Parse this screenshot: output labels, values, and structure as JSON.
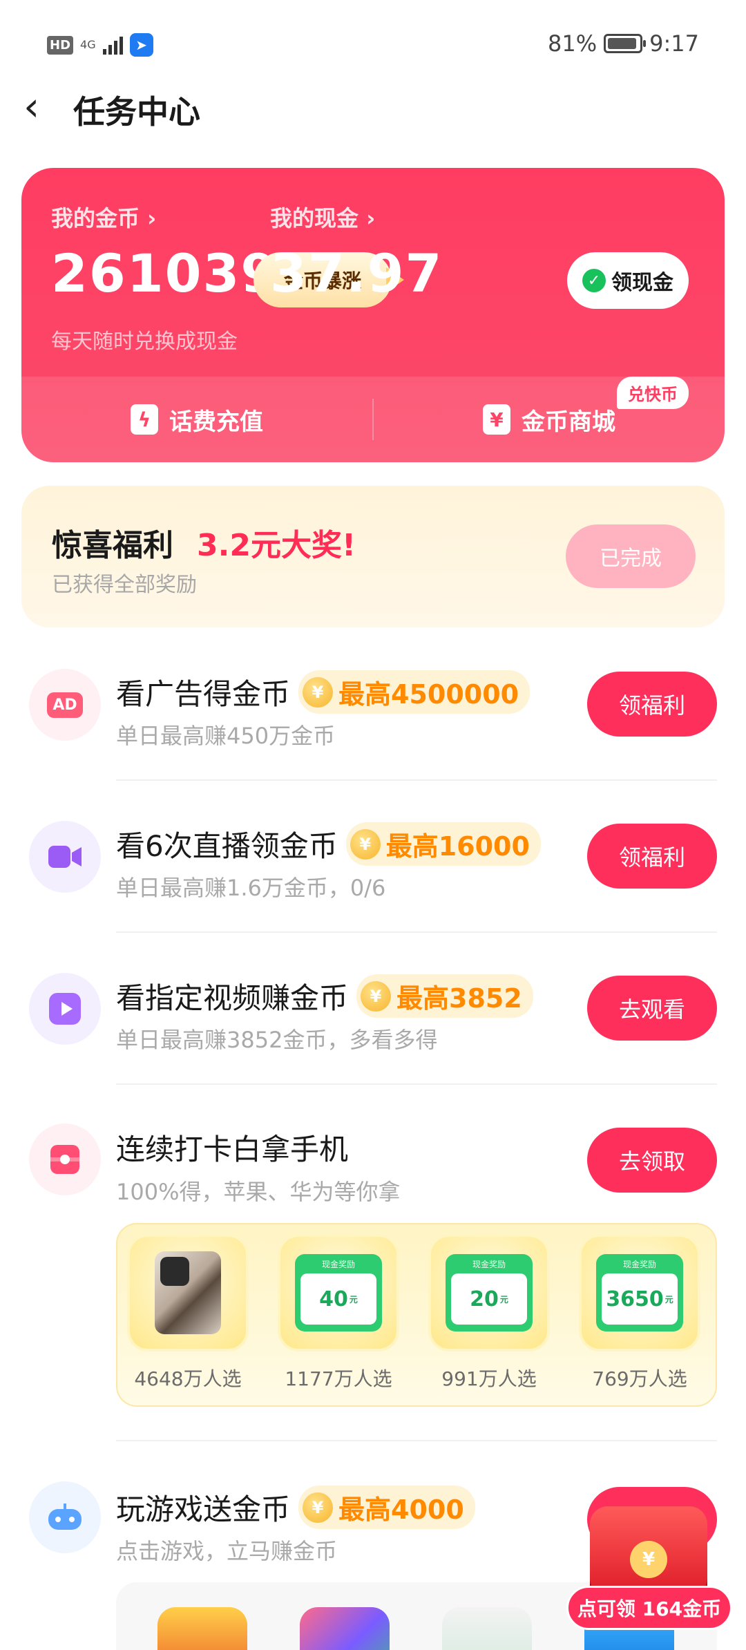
{
  "status_bar": {
    "hd": "HD",
    "signal": "4G",
    "battery_percent": "81%",
    "battery_level": 0.81,
    "time": "9:17"
  },
  "header": {
    "title": "任务中心"
  },
  "wallet": {
    "coins_label": "我的金币",
    "coins_value": "261039",
    "coins_boost": "金币暴涨",
    "cash_label": "我的现金",
    "cash_value": "37.97",
    "cash_button": "领现金",
    "subtitle": "每天随时兑换成现金",
    "phone_recharge": "话费充值",
    "coin_mall": "金币商城",
    "exchange_tag": "兑快币"
  },
  "surprise": {
    "title": "惊喜福利",
    "prize": "3.2元大奖!",
    "subtitle": "已获得全部奖励",
    "button": "已完成"
  },
  "tasks": [
    {
      "title": "看广告得金币",
      "reward": "最高4500000",
      "subtitle": "单日最高赚450万金币",
      "button": "领福利",
      "icon": "ad-icon"
    },
    {
      "title": "看6次直播领金币",
      "reward": "最高16000",
      "subtitle": "单日最高赚1.6万金币，0/6",
      "button": "领福利",
      "icon": "live-camera-icon"
    },
    {
      "title": "看指定视频赚金币",
      "reward": "最高3852",
      "subtitle": "单日最高赚3852金币，多看多得",
      "button": "去观看",
      "icon": "video-play-icon"
    },
    {
      "title": "连续打卡白拿手机",
      "reward": "",
      "subtitle": "100%得，苹果、华为等你拿",
      "button": "去领取",
      "icon": "gift-box-icon"
    },
    {
      "title": "玩游戏送金币",
      "reward": "最高4000",
      "subtitle": "点击游戏，立马赚金币",
      "button": "",
      "icon": "gamepad-icon"
    }
  ],
  "prizes": [
    {
      "kind": "phone",
      "label": "4648万人选"
    },
    {
      "kind": "cash",
      "card_title": "现金奖励",
      "amount": "40",
      "unit": "元",
      "label": "1177万人选"
    },
    {
      "kind": "cash",
      "card_title": "现金奖励",
      "amount": "20",
      "unit": "元",
      "label": "991万人选"
    },
    {
      "kind": "cash",
      "card_title": "现金奖励",
      "amount": "3650",
      "unit": "元",
      "label": "769万人选"
    }
  ],
  "floating_promo": {
    "label": "点可领 164金币"
  },
  "colors": {
    "primary": "#ff2f5c",
    "wallet_bg": "#ff3d62",
    "reward_text": "#ff8a00",
    "cash_green": "#2ecc71"
  }
}
